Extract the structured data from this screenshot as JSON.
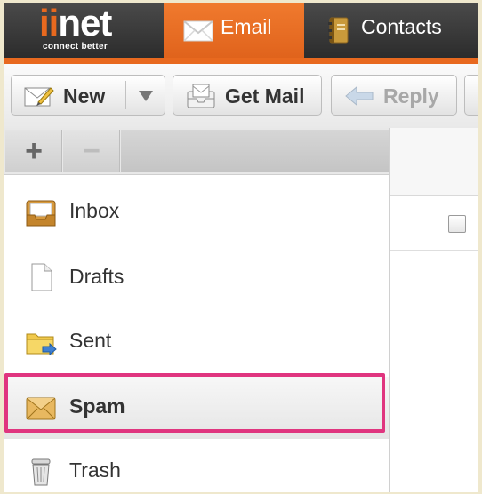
{
  "brand": {
    "logo_ii": "ii",
    "logo_net": "net",
    "tagline": "connect better"
  },
  "tabs": [
    {
      "label": "Email",
      "icon": "envelope-icon",
      "active": true
    },
    {
      "label": "Contacts",
      "icon": "address-book-icon",
      "active": false
    }
  ],
  "toolbar": {
    "new_label": "New",
    "get_mail_label": "Get Mail",
    "reply_label": "Reply"
  },
  "pane_tools": {
    "add_symbol": "+",
    "remove_symbol": "−"
  },
  "folders": [
    {
      "label": "Inbox",
      "icon": "inbox-icon"
    },
    {
      "label": "Drafts",
      "icon": "document-icon"
    },
    {
      "label": "Sent",
      "icon": "sent-folder-icon"
    },
    {
      "label": "Spam",
      "icon": "spam-envelope-icon",
      "selected": true
    },
    {
      "label": "Trash",
      "icon": "trash-icon"
    }
  ],
  "colors": {
    "accent": "#e8691f",
    "highlight": "#e0357f",
    "topbar": "#333333"
  }
}
